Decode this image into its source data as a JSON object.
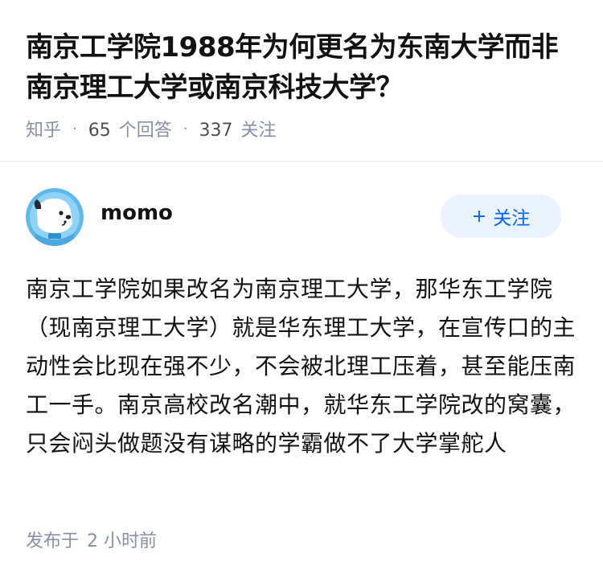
{
  "question": {
    "title": "南京工学院1988年为何更名为东南大学而非南京理工大学或南京科技大学？",
    "source": "知乎",
    "answer_count": "65",
    "answer_label": "个回答",
    "follower_count": "337",
    "follower_label": "关注"
  },
  "author": {
    "avatar_icon": "cartoon-dog-avatar",
    "name": "momo",
    "follow_button": {
      "icon": "plus-icon",
      "plus": "+",
      "label": "关注"
    }
  },
  "answer": {
    "content": "南京工学院如果改名为南京理工大学，那华东工学院（现南京理工大学）就是华东理工大学，在宣传口的主动性会比现在强不少，不会被北理工压着，甚至能压南工一手。南京高校改名潮中，就华东工学院改的窝囊，只会闷头做题没有谋略的学霸做不了大学掌舵人",
    "published_label": "发布于",
    "published_time": "2 小时前"
  },
  "colors": {
    "primary_blue": "#0066ff",
    "follow_bg": "#e9f2fe",
    "meta_gray": "#8590a6",
    "text": "#121212",
    "avatar_bg": "#5fb8ec"
  }
}
